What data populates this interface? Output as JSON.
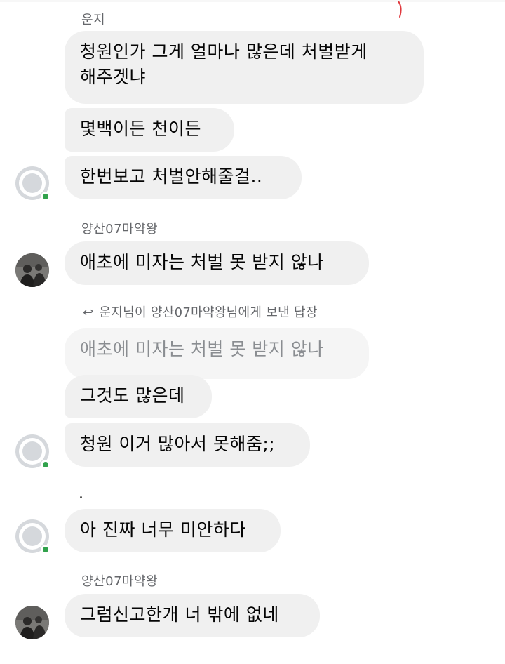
{
  "conversation": {
    "groups": [
      {
        "sender": "운지",
        "messages": [
          "청원인가 그게 얼마나 많은데 처벌받게\n해주겟냐",
          "몇백이든 천이든",
          "한번보고 처벌안해줄걸.."
        ]
      },
      {
        "sender": "양산07마약왕",
        "messages": [
          "애초에 미자는 처벌 못 받지 않나"
        ]
      },
      {
        "reply_header": "운지님이 양산07마약왕님에게 보낸 답장",
        "quoted": "애초에 미자는 처벌 못 받지 않나",
        "messages": [
          "그것도 많은데",
          "청원 이거 많아서 못해줌;;"
        ]
      },
      {
        "messages": [
          "아 진짜 너무 미안하다"
        ]
      },
      {
        "sender": "양산07마약왕",
        "messages": [
          "그럼신고한개 너 밖에 없네"
        ]
      }
    ]
  },
  "icons": {
    "reply": "reply-arrow-icon",
    "default_avatar": "default-avatar-icon",
    "online": "online-status-icon"
  },
  "colors": {
    "bubble": "#f0f0f0",
    "online": "#31a24c",
    "sender_text": "#65676b",
    "quoted_text": "#8a8d91"
  }
}
